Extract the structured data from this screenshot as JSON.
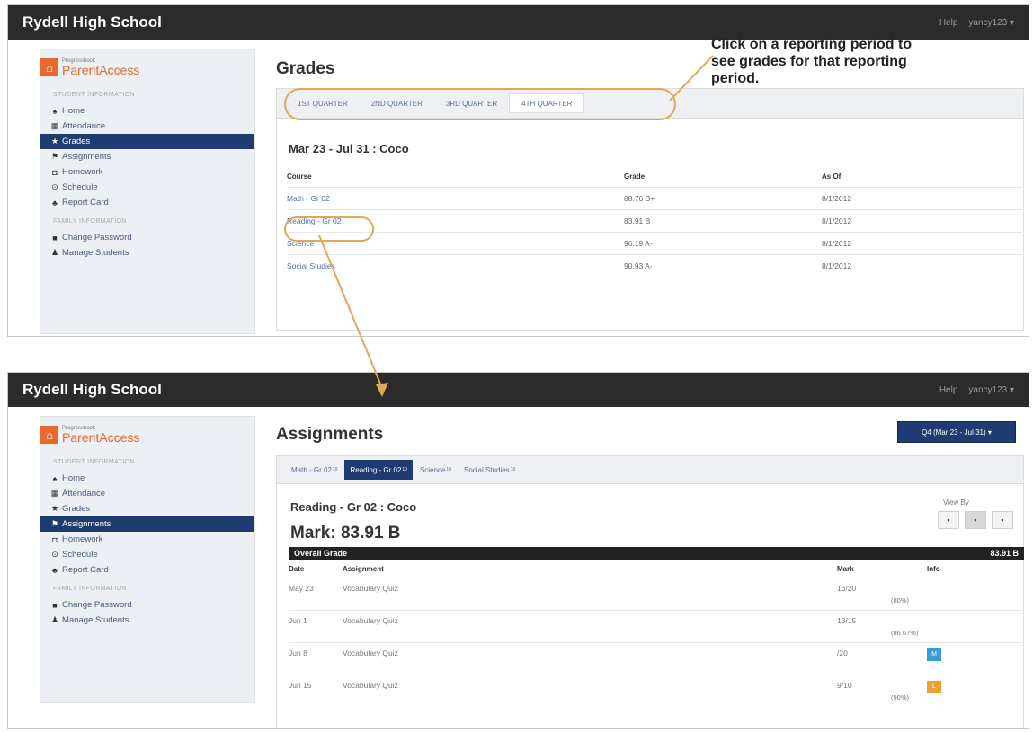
{
  "top": {
    "school": "Rydell High School",
    "help": "Help",
    "user": "yancy123 ▾",
    "title": "Grades",
    "quarters": [
      "1ST QUARTER",
      "2ND QUARTER",
      "3RD QUARTER",
      "4TH QUARTER"
    ],
    "period_heading": "Mar 23 - Jul 31 : Coco",
    "columns": [
      "Course",
      "Grade",
      "As Of"
    ],
    "rows": [
      {
        "course": "Math - Gr 02",
        "grade": "88.76 B+",
        "as_of": "8/1/2012"
      },
      {
        "course": "Reading - Gr 02",
        "grade": "83.91 B",
        "as_of": "8/1/2012"
      },
      {
        "course": "Science",
        "grade": "96.19 A-",
        "as_of": "8/1/2012"
      },
      {
        "course": "Social Studies",
        "grade": "90.93 A-",
        "as_of": "8/1/2012"
      }
    ]
  },
  "sidebar": {
    "logo_small": "Progressbook",
    "logo_big": "ParentAccess",
    "student_section": "STUDENT INFORMATION",
    "family_section": "FAMILY INFORMATION",
    "items": [
      "Home",
      "Attendance",
      "Grades",
      "Assignments",
      "Homework",
      "Schedule",
      "Report Card"
    ],
    "family_items": [
      "Change Password",
      "Manage Students"
    ],
    "icons": [
      "home-icon",
      "attendance-icon",
      "grades-icon",
      "assignments-icon",
      "homework-icon",
      "schedule-icon",
      "report-card-icon"
    ],
    "family_icons": [
      "lock-icon",
      "user-icon"
    ]
  },
  "callout": "Click on a reporting period to see grades for that reporting period.",
  "bottom": {
    "school": "Rydell High School",
    "help": "Help",
    "user": "yancy123 ▾",
    "title": "Assignments",
    "quarter_button": "Q4 (Mar 23 - Jul 31) ▾",
    "course_tabs": [
      {
        "label": "Math - Gr 02",
        "count": "10"
      },
      {
        "label": "Reading - Gr 02",
        "count": "10"
      },
      {
        "label": "Science",
        "count": "10"
      },
      {
        "label": "Social Studies",
        "count": "10"
      }
    ],
    "heading": "Reading - Gr 02 : Coco",
    "mark": "Mark: 83.91 B",
    "view_by": "View By",
    "overall_label": "Overall Grade",
    "overall_value": "83.91 B",
    "columns": [
      "Date",
      "Assignment",
      "Mark",
      "Info"
    ],
    "rows": [
      {
        "date": "May 23",
        "assignment": "Vocabulary Quiz",
        "mark": "16/20",
        "pct": "(80%)",
        "info": ""
      },
      {
        "date": "Jun 1",
        "assignment": "Vocabulary Quiz",
        "mark": "13/15",
        "pct": "(86.67%)",
        "info": ""
      },
      {
        "date": "Jun 8",
        "assignment": "Vocabulary Quiz",
        "mark": "/20",
        "pct": "",
        "info": "M"
      },
      {
        "date": "Jun 15",
        "assignment": "Vocabulary Quiz",
        "mark": "9/10",
        "pct": "(90%)",
        "info": "L"
      }
    ]
  }
}
